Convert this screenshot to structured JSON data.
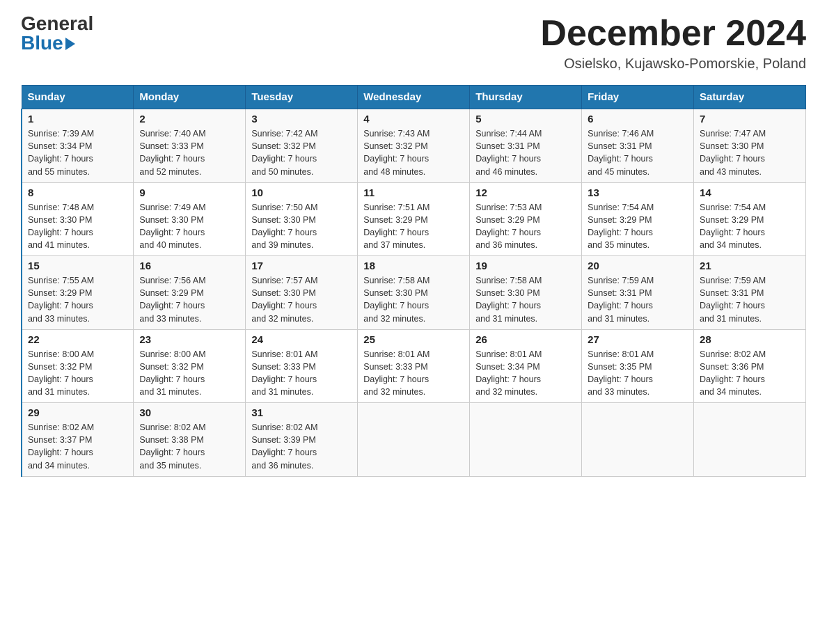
{
  "header": {
    "logo_general": "General",
    "logo_blue": "Blue",
    "month_title": "December 2024",
    "location": "Osielsko, Kujawsko-Pomorskie, Poland"
  },
  "days_of_week": [
    "Sunday",
    "Monday",
    "Tuesday",
    "Wednesday",
    "Thursday",
    "Friday",
    "Saturday"
  ],
  "weeks": [
    [
      {
        "day": "1",
        "sunrise": "7:39 AM",
        "sunset": "3:34 PM",
        "daylight": "7 hours and 55 minutes."
      },
      {
        "day": "2",
        "sunrise": "7:40 AM",
        "sunset": "3:33 PM",
        "daylight": "7 hours and 52 minutes."
      },
      {
        "day": "3",
        "sunrise": "7:42 AM",
        "sunset": "3:32 PM",
        "daylight": "7 hours and 50 minutes."
      },
      {
        "day": "4",
        "sunrise": "7:43 AM",
        "sunset": "3:32 PM",
        "daylight": "7 hours and 48 minutes."
      },
      {
        "day": "5",
        "sunrise": "7:44 AM",
        "sunset": "3:31 PM",
        "daylight": "7 hours and 46 minutes."
      },
      {
        "day": "6",
        "sunrise": "7:46 AM",
        "sunset": "3:31 PM",
        "daylight": "7 hours and 45 minutes."
      },
      {
        "day": "7",
        "sunrise": "7:47 AM",
        "sunset": "3:30 PM",
        "daylight": "7 hours and 43 minutes."
      }
    ],
    [
      {
        "day": "8",
        "sunrise": "7:48 AM",
        "sunset": "3:30 PM",
        "daylight": "7 hours and 41 minutes."
      },
      {
        "day": "9",
        "sunrise": "7:49 AM",
        "sunset": "3:30 PM",
        "daylight": "7 hours and 40 minutes."
      },
      {
        "day": "10",
        "sunrise": "7:50 AM",
        "sunset": "3:30 PM",
        "daylight": "7 hours and 39 minutes."
      },
      {
        "day": "11",
        "sunrise": "7:51 AM",
        "sunset": "3:29 PM",
        "daylight": "7 hours and 37 minutes."
      },
      {
        "day": "12",
        "sunrise": "7:53 AM",
        "sunset": "3:29 PM",
        "daylight": "7 hours and 36 minutes."
      },
      {
        "day": "13",
        "sunrise": "7:54 AM",
        "sunset": "3:29 PM",
        "daylight": "7 hours and 35 minutes."
      },
      {
        "day": "14",
        "sunrise": "7:54 AM",
        "sunset": "3:29 PM",
        "daylight": "7 hours and 34 minutes."
      }
    ],
    [
      {
        "day": "15",
        "sunrise": "7:55 AM",
        "sunset": "3:29 PM",
        "daylight": "7 hours and 33 minutes."
      },
      {
        "day": "16",
        "sunrise": "7:56 AM",
        "sunset": "3:29 PM",
        "daylight": "7 hours and 33 minutes."
      },
      {
        "day": "17",
        "sunrise": "7:57 AM",
        "sunset": "3:30 PM",
        "daylight": "7 hours and 32 minutes."
      },
      {
        "day": "18",
        "sunrise": "7:58 AM",
        "sunset": "3:30 PM",
        "daylight": "7 hours and 32 minutes."
      },
      {
        "day": "19",
        "sunrise": "7:58 AM",
        "sunset": "3:30 PM",
        "daylight": "7 hours and 31 minutes."
      },
      {
        "day": "20",
        "sunrise": "7:59 AM",
        "sunset": "3:31 PM",
        "daylight": "7 hours and 31 minutes."
      },
      {
        "day": "21",
        "sunrise": "7:59 AM",
        "sunset": "3:31 PM",
        "daylight": "7 hours and 31 minutes."
      }
    ],
    [
      {
        "day": "22",
        "sunrise": "8:00 AM",
        "sunset": "3:32 PM",
        "daylight": "7 hours and 31 minutes."
      },
      {
        "day": "23",
        "sunrise": "8:00 AM",
        "sunset": "3:32 PM",
        "daylight": "7 hours and 31 minutes."
      },
      {
        "day": "24",
        "sunrise": "8:01 AM",
        "sunset": "3:33 PM",
        "daylight": "7 hours and 31 minutes."
      },
      {
        "day": "25",
        "sunrise": "8:01 AM",
        "sunset": "3:33 PM",
        "daylight": "7 hours and 32 minutes."
      },
      {
        "day": "26",
        "sunrise": "8:01 AM",
        "sunset": "3:34 PM",
        "daylight": "7 hours and 32 minutes."
      },
      {
        "day": "27",
        "sunrise": "8:01 AM",
        "sunset": "3:35 PM",
        "daylight": "7 hours and 33 minutes."
      },
      {
        "day": "28",
        "sunrise": "8:02 AM",
        "sunset": "3:36 PM",
        "daylight": "7 hours and 34 minutes."
      }
    ],
    [
      {
        "day": "29",
        "sunrise": "8:02 AM",
        "sunset": "3:37 PM",
        "daylight": "7 hours and 34 minutes."
      },
      {
        "day": "30",
        "sunrise": "8:02 AM",
        "sunset": "3:38 PM",
        "daylight": "7 hours and 35 minutes."
      },
      {
        "day": "31",
        "sunrise": "8:02 AM",
        "sunset": "3:39 PM",
        "daylight": "7 hours and 36 minutes."
      },
      null,
      null,
      null,
      null
    ]
  ],
  "labels": {
    "sunrise": "Sunrise:",
    "sunset": "Sunset:",
    "daylight": "Daylight:"
  }
}
